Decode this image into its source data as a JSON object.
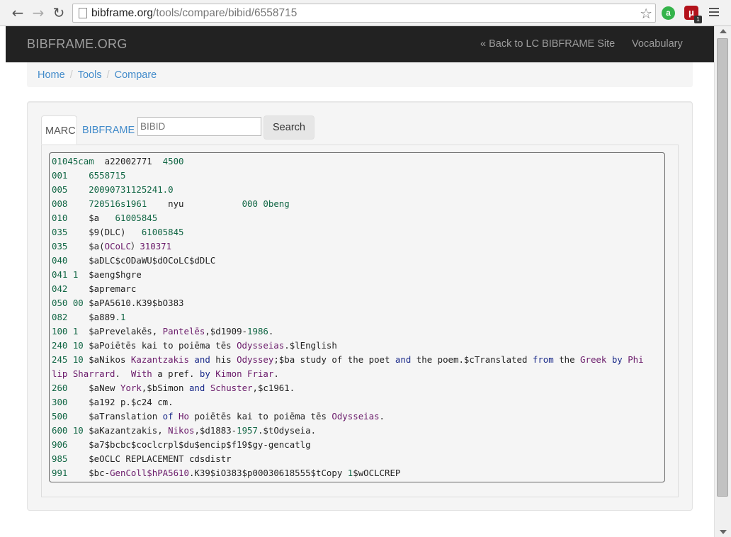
{
  "browser": {
    "url_host": "bibframe.org",
    "url_path": "/tools/compare/bibid/6558715",
    "back_icon": "back-arrow-icon",
    "forward_icon": "forward-arrow-icon",
    "reload_icon": "reload-icon",
    "ext_green_glyph": "a",
    "ext_red_glyph": "μ",
    "ext_badge": "1"
  },
  "navbar": {
    "brand": "BIBFRAME.ORG",
    "back_link": "« Back to LC BIBFRAME Site",
    "vocab_link": "Vocabulary"
  },
  "breadcrumb": [
    "Home",
    "Tools",
    "Compare"
  ],
  "tabs": {
    "marc": "MARC",
    "bibframe": "BIBFRAME"
  },
  "search": {
    "placeholder": "BIBID",
    "button": "Search"
  },
  "colors": {
    "navbar_bg": "#222222",
    "link": "#428bca",
    "tag": "#116644",
    "keyword": "#1a2a8a",
    "value": "#6a1a6a"
  },
  "marc_lines": [
    [
      [
        "t",
        "01045cam"
      ],
      [
        "",
        "  a22002771  "
      ],
      [
        "t",
        "4500"
      ]
    ],
    [
      [
        "t",
        "001    6558715"
      ]
    ],
    [
      [
        "t",
        "005    20090731125241.0"
      ]
    ],
    [
      [
        "t",
        "008    720516s1961"
      ],
      [
        "",
        "    nyu           "
      ],
      [
        "t",
        "000 0beng"
      ]
    ],
    [
      [
        "t",
        "010    "
      ],
      [
        "",
        "$a   "
      ],
      [
        "t",
        "61005845"
      ]
    ],
    [
      [
        "t",
        "035    "
      ],
      [
        "",
        "$9(DLC)   "
      ],
      [
        "t",
        "61005845"
      ]
    ],
    [
      [
        "t",
        "035    "
      ],
      [
        "",
        "$a("
      ],
      [
        "v",
        "OCoLC"
      ],
      [
        "",
        "）"
      ],
      [
        "v",
        "310371"
      ]
    ],
    [
      [
        "t",
        "040    "
      ],
      [
        "",
        "$aDLC$cODaWU$dOCoLC$dDLC"
      ]
    ],
    [
      [
        "t",
        "041 1  "
      ],
      [
        "",
        "$aeng$hgre"
      ]
    ],
    [
      [
        "t",
        "042    "
      ],
      [
        "",
        "$apremarc"
      ]
    ],
    [
      [
        "t",
        "050 00 "
      ],
      [
        "",
        "$aPA5610.K39$bO383"
      ]
    ],
    [
      [
        "t",
        "082    "
      ],
      [
        "",
        "$a889"
      ],
      [
        "t",
        ".1"
      ]
    ],
    [
      [
        "t",
        "100 1  "
      ],
      [
        "",
        "$aPrevelakēs, "
      ],
      [
        "v",
        "Pantelēs"
      ],
      [
        "",
        ",$d1909-"
      ],
      [
        "t",
        "1986"
      ],
      [
        "",
        "."
      ]
    ],
    [
      [
        "t",
        "240 10 "
      ],
      [
        "",
        "$aPoiētēs kai to poiēma tēs "
      ],
      [
        "v",
        "Odysseias"
      ],
      [
        "",
        ".$lEnglish"
      ]
    ],
    [
      [
        "t",
        "245 10 "
      ],
      [
        "",
        "$aNikos "
      ],
      [
        "v",
        "Kazantzakis"
      ],
      [
        "k",
        " and "
      ],
      [
        "",
        "his "
      ],
      [
        "v",
        "Odyssey"
      ],
      [
        "",
        ";$ba study of the poet "
      ],
      [
        "k",
        "and"
      ],
      [
        "",
        " the poem.$cTranslated "
      ],
      [
        "k",
        "from"
      ],
      [
        "",
        " the "
      ],
      [
        "v",
        "Greek"
      ],
      [
        "k",
        " by "
      ],
      [
        "v",
        "Phi"
      ]
    ],
    [
      [
        "v",
        "lip Sharrard"
      ],
      [
        "",
        ".  "
      ],
      [
        "v",
        "With"
      ],
      [
        "",
        " a pref. "
      ],
      [
        "k",
        "by"
      ],
      [
        "v",
        " Kimon Friar"
      ],
      [
        "",
        "."
      ]
    ],
    [
      [
        "t",
        "260    "
      ],
      [
        "",
        "$aNew "
      ],
      [
        "v",
        "York"
      ],
      [
        "",
        ",$bSimon "
      ],
      [
        "k",
        "and"
      ],
      [
        "v",
        " Schuster"
      ],
      [
        "",
        ",$c1961."
      ]
    ],
    [
      [
        "t",
        "300    "
      ],
      [
        "",
        "$a192 p.$c24 cm."
      ]
    ],
    [
      [
        "t",
        "500    "
      ],
      [
        "",
        "$aTranslation "
      ],
      [
        "k",
        "of"
      ],
      [
        "v",
        " Ho"
      ],
      [
        "",
        " poiētēs kai to poiēma tēs "
      ],
      [
        "v",
        "Odysseias"
      ],
      [
        "",
        "."
      ]
    ],
    [
      [
        "t",
        "600 10 "
      ],
      [
        "",
        "$aKazantzakis, "
      ],
      [
        "v",
        "Nikos"
      ],
      [
        "",
        ",$d1883-"
      ],
      [
        "t",
        "1957"
      ],
      [
        "",
        ".$tOdyseia."
      ]
    ],
    [
      [
        "t",
        "906    "
      ],
      [
        "",
        "$a7$bcbc$coclcrpl$du$encip$f19$gy-gencatlg"
      ]
    ],
    [
      [
        "t",
        "985    "
      ],
      [
        "",
        "$eOCLC REPLACEMENT cdsdistr"
      ]
    ],
    [
      [
        "t",
        "991    "
      ],
      [
        "",
        "$bc-"
      ],
      [
        "v",
        "GenColl"
      ],
      [
        "v",
        "$hPA5610"
      ],
      [
        "",
        ".K39$iO383$p00030618555$tCopy "
      ],
      [
        "t",
        "1"
      ],
      [
        "",
        "$wOCLCREP"
      ]
    ]
  ]
}
